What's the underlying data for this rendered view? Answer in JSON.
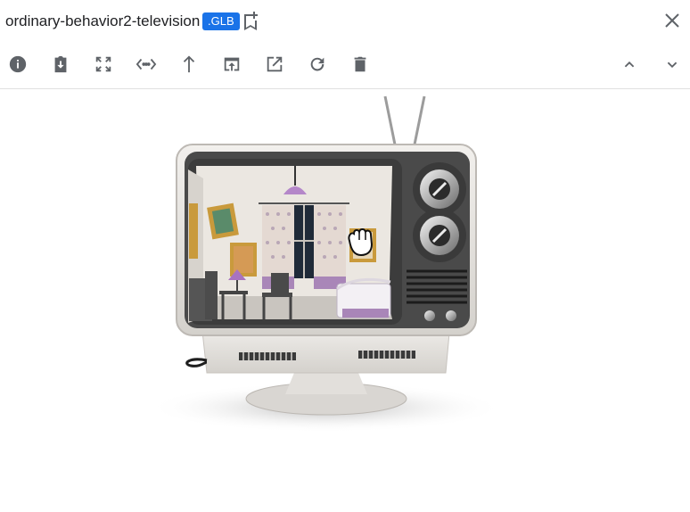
{
  "header": {
    "title": "ordinary-behavior2-television",
    "badge": ".GLB"
  },
  "toolbar": {
    "left_icons": [
      "info-icon",
      "download-to-clipboard-icon",
      "fullscreen-icon",
      "code-embed-icon",
      "upload-arrow-icon",
      "open-in-window-icon",
      "open-external-icon",
      "refresh-icon",
      "delete-icon"
    ],
    "right_icons": [
      "chevron-up-icon",
      "chevron-down-icon"
    ]
  },
  "colors": {
    "icon": "#5f6368",
    "badge": "#1a73e8",
    "divider": "#e0e0e0",
    "tv_body": "#e6e3df",
    "tv_panel": "#4a4a4a"
  },
  "viewer": {
    "model": "3d-television-with-room-inside",
    "cursor": "grab-hand-cursor"
  }
}
